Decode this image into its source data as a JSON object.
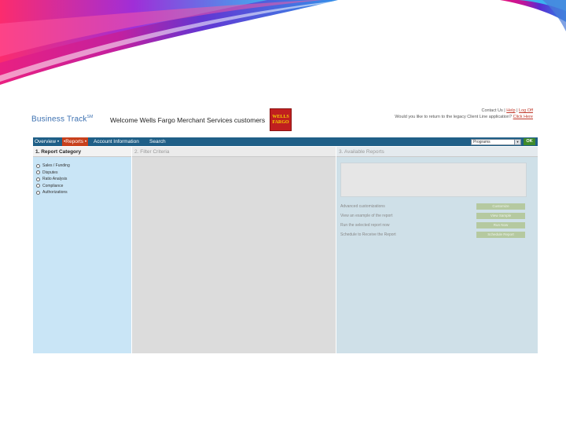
{
  "header": {
    "logo_text": "Business Track",
    "logo_mark": "SM",
    "welcome": "Welcome Wells Fargo Merchant Services customers",
    "brand_logo": [
      "WELLS",
      "FARGO"
    ],
    "links": {
      "contact": "Contact Us",
      "help": "Help",
      "logout": "Log Off",
      "legacy_question": "Would you like to return to the legacy Client Line application?",
      "click_here": "Click Here"
    }
  },
  "nav": {
    "items": [
      "Overview •",
      "•Reports •",
      "Account Information",
      "Search"
    ],
    "select_value": "Programs",
    "ok_label": "OK"
  },
  "columns": {
    "category": {
      "title": "1. Report Category",
      "items": [
        "Sales / Funding",
        "Disputes",
        "Ratio Analysis",
        "Compliance",
        "Authorizations"
      ]
    },
    "filter": {
      "title": "2. Filter Criteria"
    },
    "reports": {
      "title": "3. Available Reports",
      "actions": [
        {
          "label": "Advanced customizations",
          "button": "Customize"
        },
        {
          "label": "View an example of the report",
          "button": "View Sample"
        },
        {
          "label": "Run the selected report now",
          "button": "Run Now"
        },
        {
          "label": "Schedule to Receive the Report",
          "button": "Schedule Report"
        }
      ]
    }
  },
  "colors": {
    "nav_bg": "#1f5f87",
    "nav_active": "#c8401c",
    "category_bg": "#c9e5f6",
    "filter_bg": "#dcdcdc",
    "reports_bg": "#cfe0e8",
    "brand_red": "#c01f1f"
  }
}
